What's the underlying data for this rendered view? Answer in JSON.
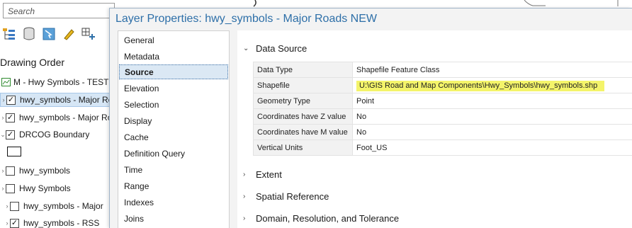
{
  "contents": {
    "search_placeholder": "Search",
    "drawing_order_label": "Drawing Order",
    "layers": [
      {
        "label": "M - Hwy Symbols - TEST",
        "checked": false
      },
      {
        "label": "hwy_symbols - Major Ro",
        "checked": true
      },
      {
        "label": "hwy_symbols - Major Ro",
        "checked": true
      },
      {
        "label": "DRCOG Boundary",
        "checked": true
      },
      {
        "label": "hwy_symbols",
        "checked": false
      },
      {
        "label": "Hwy Symbols",
        "checked": false
      },
      {
        "label": "hwy_symbols - Major",
        "checked": false
      },
      {
        "label": "hwy_symbols - RSS",
        "checked": true
      }
    ],
    "toolbar_icons": [
      "list-by-drawing-order-icon",
      "list-by-source-icon",
      "list-by-selection-icon",
      "list-by-editing-icon",
      "list-by-snapping-icon"
    ]
  },
  "dialog": {
    "title": "Layer Properties: hwy_symbols - Major Roads NEW",
    "nav_items": [
      "General",
      "Metadata",
      "Source",
      "Elevation",
      "Selection",
      "Display",
      "Cache",
      "Definition Query",
      "Time",
      "Range",
      "Indexes",
      "Joins"
    ],
    "active_nav": "Source",
    "sections": {
      "data_source": "Data Source",
      "extent": "Extent",
      "spatial_reference": "Spatial Reference",
      "domain": "Domain, Resolution, and Tolerance"
    },
    "data_source_rows": [
      {
        "key": "Data Type",
        "value": "Shapefile Feature Class"
      },
      {
        "key": "Shapefile",
        "value": "U:\\GIS Road and Map Components\\Hwy_Symbols\\hwy_symbols.shp"
      },
      {
        "key": "Geometry Type",
        "value": "Point"
      },
      {
        "key": "Coordinates have Z value",
        "value": "No"
      },
      {
        "key": "Coordinates have M value",
        "value": "No"
      },
      {
        "key": "Vertical Units",
        "value": "Foot_US"
      }
    ]
  },
  "colors": {
    "title_blue": "#2d6fa8",
    "highlight_yellow": "#f4f46a",
    "selected_row": "#d6e6f5"
  }
}
